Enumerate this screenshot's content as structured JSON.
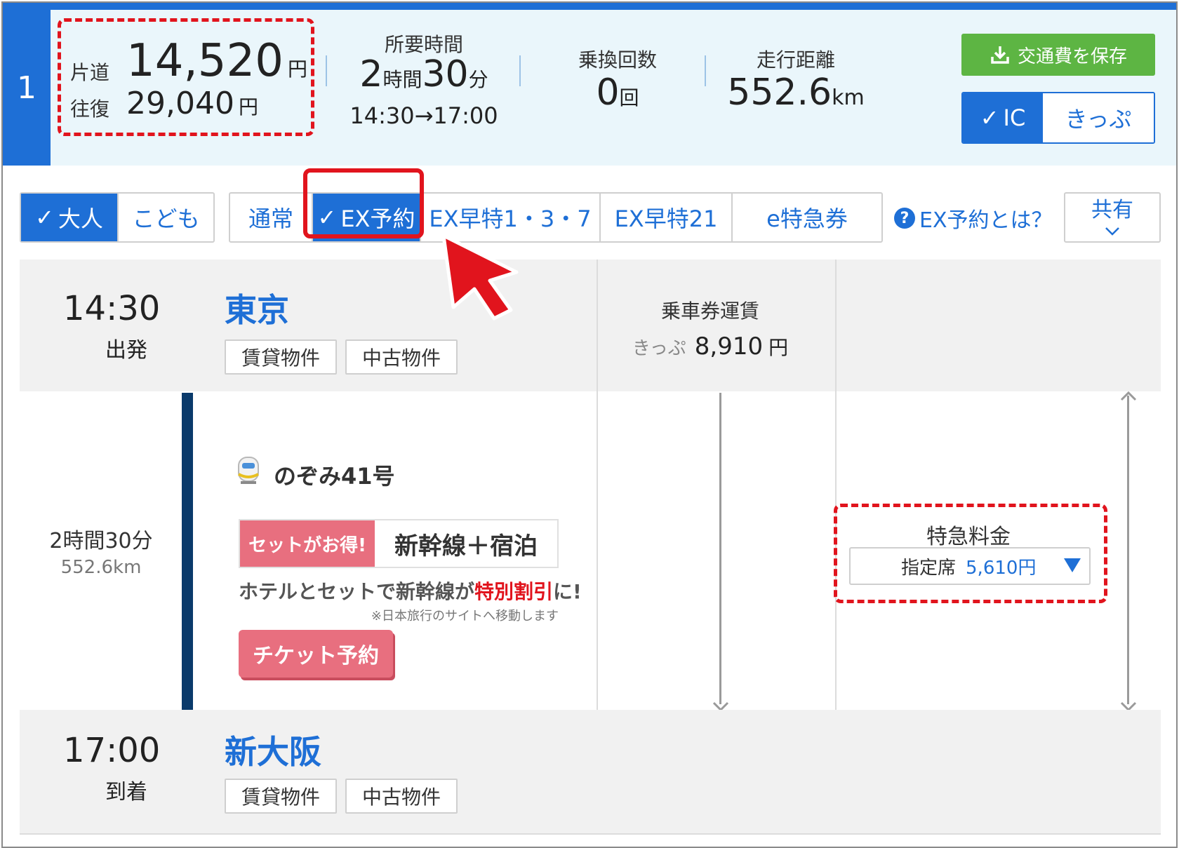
{
  "route": {
    "number": "1"
  },
  "fare": {
    "oneway_label": "片道",
    "oneway_value": "14,520",
    "oneway_unit": "円",
    "round_label": "往復",
    "round_value": "29,040",
    "round_unit": "円"
  },
  "duration": {
    "label": "所要時間",
    "hours": "2",
    "hours_unit": "時間",
    "minutes": "30",
    "minutes_unit": "分",
    "range": "14:30→17:00"
  },
  "transfers": {
    "label": "乗換回数",
    "value": "0",
    "unit": "回"
  },
  "distance": {
    "label": "走行距離",
    "value": "552.6",
    "unit": "km"
  },
  "actions": {
    "save_label": "交通費を保存",
    "ic_label": "IC",
    "ticket_label": "きっぷ"
  },
  "passenger": {
    "adult": "大人",
    "child": "こども"
  },
  "fare_types": [
    "通常",
    "EX予約",
    "EX早特1・3・7",
    "EX早特21",
    "e特急券"
  ],
  "help_label": "EX予約とは？",
  "share": {
    "label": "共有"
  },
  "departure": {
    "time": "14:30",
    "sub": "出発",
    "station": "東京",
    "tags": [
      "賃貸物件",
      "中古物件"
    ]
  },
  "arrival": {
    "time": "17:00",
    "sub": "到着",
    "station": "新大阪",
    "tags": [
      "賃貸物件",
      "中古物件"
    ]
  },
  "base_fare": {
    "label": "乗車券運賃",
    "kind": "きっぷ",
    "value": "8,910",
    "unit": "円"
  },
  "segment": {
    "duration": "2時間30分",
    "distance": "552.6km",
    "train": "のぞみ41号"
  },
  "promo": {
    "badge": "セットがお得!",
    "text": "新幹線＋宿泊",
    "note_before": "ホテルとセットで新幹線が",
    "note_highlight": "特別割引",
    "note_after": "に!",
    "small": "※日本旅行のサイトへ移動します",
    "button": "チケット予約"
  },
  "express": {
    "label": "特急料金",
    "seat": "指定席",
    "price": "5,610円"
  },
  "colors": {
    "primary": "#1e6fd6",
    "save_green": "#5db543",
    "highlight_red": "#e1141d",
    "promo_pink": "#e86f7f",
    "rail_navy": "#0a3a6b"
  }
}
